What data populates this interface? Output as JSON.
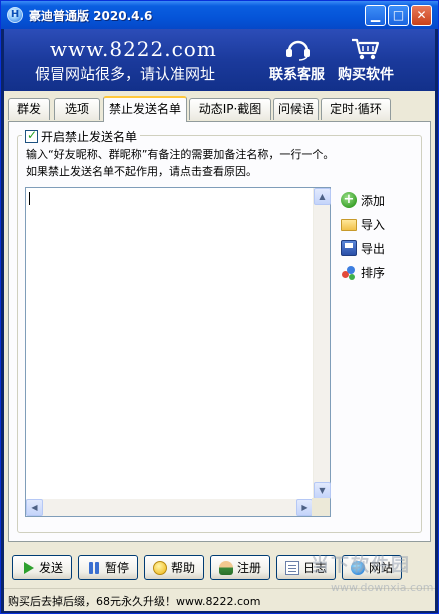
{
  "titlebar": {
    "title": "豪迪普通版 2020.4.6",
    "app_icon_letter": "H",
    "min_glyph": "▁",
    "max_glyph": "□",
    "close_glyph": "✕"
  },
  "banner": {
    "site": "www.8222.com",
    "slogan": "假冒网站很多，请认准网址",
    "service_label": "联系客服",
    "buy_label": "购买软件"
  },
  "tabs": [
    {
      "label": "群发",
      "active": false
    },
    {
      "label": "选项",
      "active": false
    },
    {
      "label": "禁止发送名单",
      "active": true
    },
    {
      "label": "动态IP·截图",
      "active": false
    },
    {
      "label": "问候语",
      "active": false
    },
    {
      "label": "定时·循环",
      "active": false
    }
  ],
  "panel": {
    "checkbox_label": "开启禁止发送名单",
    "checkbox_checked": true,
    "desc_line1": "输入“好友昵称、群昵称”有备注的需要加备注名称，一行一个。",
    "desc_line2": "如果禁止发送名单不起作用，请点击查看原因。",
    "textarea_value": "",
    "side_buttons": {
      "add": "添加",
      "import": "导入",
      "export": "导出",
      "sort": "排序"
    }
  },
  "bottom_buttons": {
    "send": "发送",
    "pause": "暂停",
    "help": "帮助",
    "register": "注册",
    "log": "日志",
    "website": "网站"
  },
  "statusbar": {
    "text": "购买后去掉后缀，68元永久升级！www.8222.com"
  },
  "watermark": {
    "text": "当下软件园",
    "url": "www.downxia.com"
  },
  "colors": {
    "titlebar": "#0554d8",
    "banner": "#1b3a9c",
    "window_bg": "#ece9d8",
    "tab_highlight": "#ffc83c"
  }
}
